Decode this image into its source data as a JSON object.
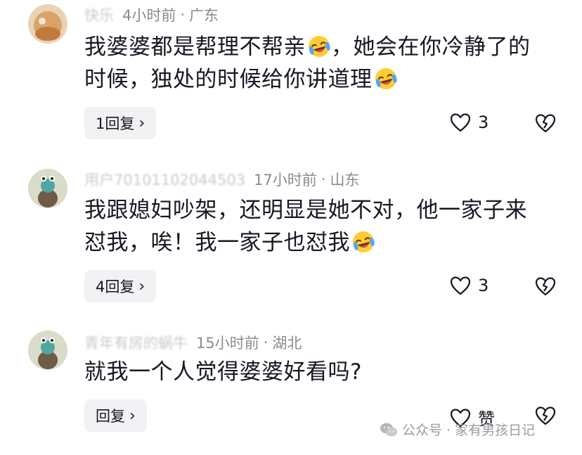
{
  "comments": [
    {
      "username": "快乐",
      "time": "4小时前",
      "location": "广东",
      "text_line1": "我婆婆都是帮理不帮亲",
      "text_line1b": "，她会在你冷静了的",
      "text_line2": "时候，独处的时候给你讲道理",
      "reply_label": "1回复",
      "likes": "3"
    },
    {
      "username": "用户70101102044503",
      "time": "17小时前",
      "location": "山东",
      "text_line1": "我跟媳妇吵架，还明显是她不对，他一家子来",
      "text_line2": "怼我，唉！我一家子也怼我",
      "reply_label": "4回复",
      "likes": "3"
    },
    {
      "username": "青年有房的蜗牛",
      "time": "15小时前",
      "location": "湖北",
      "text_line1": "就我一个人觉得婆婆好看吗?",
      "reply_label": "回复",
      "likes": "赞"
    }
  ],
  "separator": "·",
  "watermark": {
    "text": "公众号 · 家有男孩日记",
    "icon": "wechat-icon"
  },
  "colors": {
    "text": "#161823",
    "meta": "#8a8b91",
    "reply_bg": "#f2f2f4"
  }
}
